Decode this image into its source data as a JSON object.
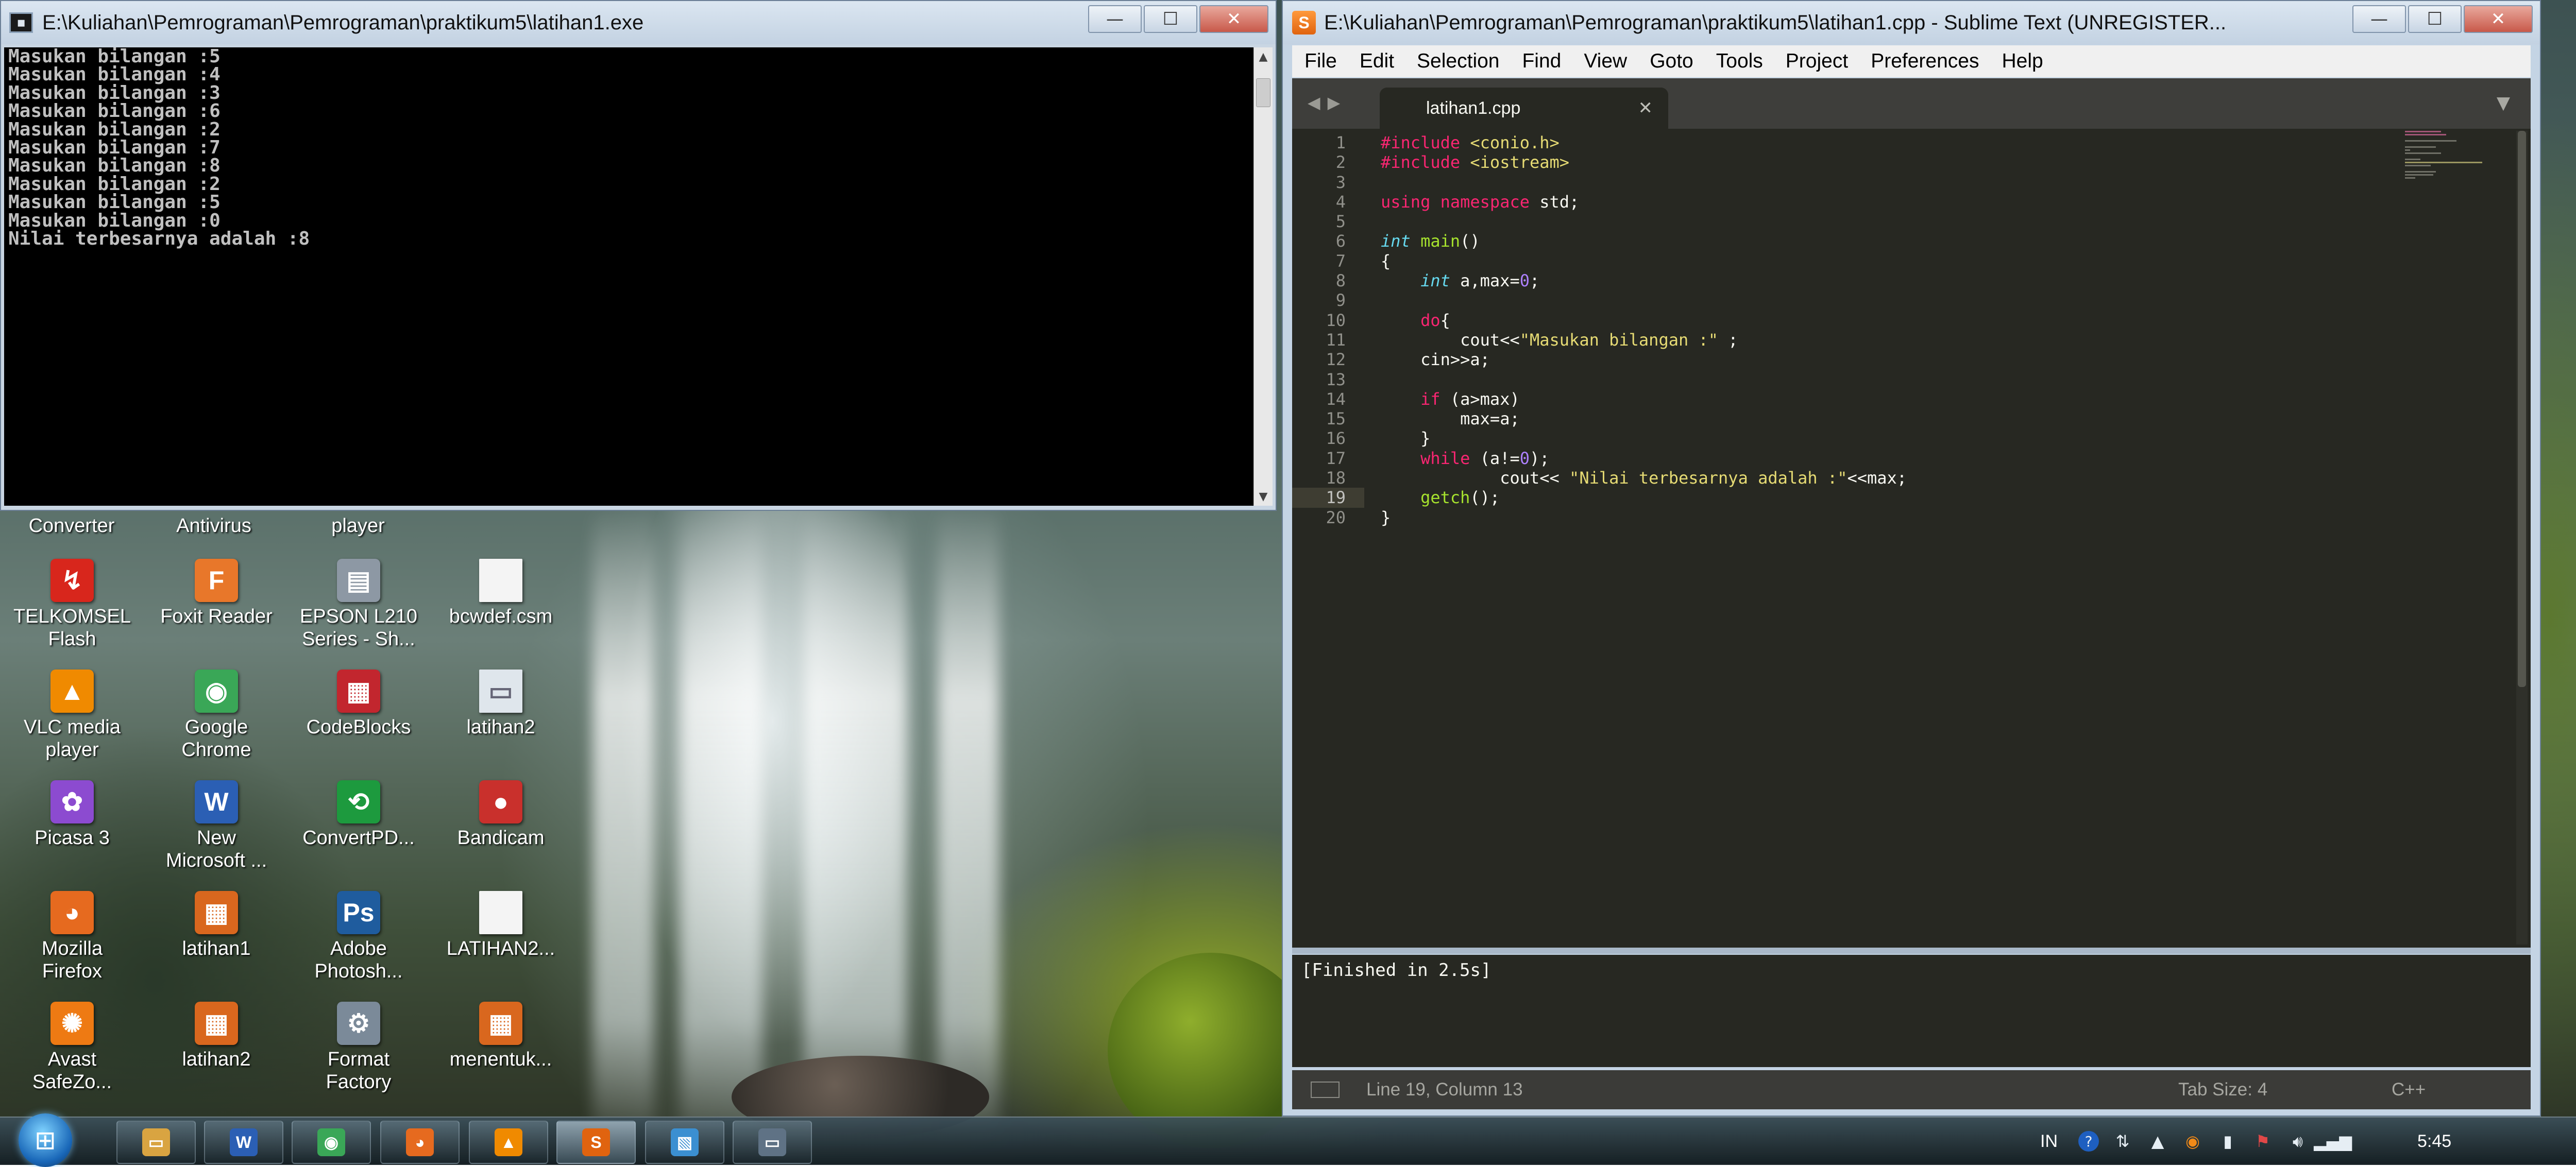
{
  "console": {
    "title": "E:\\Kuliahan\\Pemrograman\\Pemrograman\\praktikum5\\latihan1.exe",
    "output_lines": [
      "Masukan bilangan :5",
      "Masukan bilangan :4",
      "Masukan bilangan :3",
      "Masukan bilangan :6",
      "Masukan bilangan :2",
      "Masukan bilangan :7",
      "Masukan bilangan :8",
      "Masukan bilangan :2",
      "Masukan bilangan :5",
      "Masukan bilangan :0",
      "Nilai terbesarnya adalah :8"
    ],
    "controls": {
      "minimize": "—",
      "maximize": "☐",
      "close": "✕"
    }
  },
  "desktop": {
    "partial_labels": [
      "Converter",
      "Antivirus",
      "player"
    ],
    "icons": [
      {
        "label": "TELKOMSEL\nFlash",
        "icon": "telkomsel-flash-icon",
        "glyph": "↯",
        "color": "#d8261c"
      },
      {
        "label": "Foxit Reader",
        "icon": "foxit-reader-icon",
        "glyph": "F",
        "color": "#e8772a"
      },
      {
        "label": "EPSON L210\nSeries - Sh...",
        "icon": "epson-printer-icon",
        "glyph": "▤",
        "color": "#8d98a4"
      },
      {
        "label": "bcwdef.csm",
        "icon": "file-icon",
        "glyph": "",
        "color": "#f4f4f4"
      },
      {
        "label": "VLC media\nplayer",
        "icon": "vlc-icon",
        "glyph": "▲",
        "color": "#f08a00"
      },
      {
        "label": "Google\nChrome",
        "icon": "chrome-icon",
        "glyph": "◉",
        "color": "#3aa757"
      },
      {
        "label": "CodeBlocks",
        "icon": "codeblocks-icon",
        "glyph": "▦",
        "color": "#c2262e"
      },
      {
        "label": "latihan2",
        "icon": "exe-file-icon",
        "glyph": "▭",
        "color": "#dfe6ec"
      },
      {
        "label": "Picasa 3",
        "icon": "picasa-icon",
        "glyph": "✿",
        "color": "#8c4bd0"
      },
      {
        "label": "New\nMicrosoft ...",
        "icon": "word-doc-icon",
        "glyph": "W",
        "color": "#2b5fb4"
      },
      {
        "label": "ConvertPD...",
        "icon": "convertpdf-icon",
        "glyph": "⟲",
        "color": "#1d9a3e"
      },
      {
        "label": "Bandicam",
        "icon": "bandicam-icon",
        "glyph": "●",
        "color": "#c9302c"
      },
      {
        "label": "Mozilla\nFirefox",
        "icon": "firefox-icon",
        "glyph": "◕",
        "color": "#e66a1f"
      },
      {
        "label": "latihan1",
        "icon": "codeblocks-project-icon",
        "glyph": "▦",
        "color": "#d9671e"
      },
      {
        "label": "Adobe\nPhotosh...",
        "icon": "photoshop-icon",
        "glyph": "Ps",
        "color": "#1f5c9e"
      },
      {
        "label": "LATIHAN2...",
        "icon": "file-icon",
        "glyph": "",
        "color": "#f4f4f4"
      },
      {
        "label": "Avast\nSafeZo...",
        "icon": "avast-safezone-icon",
        "glyph": "✺",
        "color": "#ee7a13"
      },
      {
        "label": "latihan2",
        "icon": "codeblocks-project-icon",
        "glyph": "▦",
        "color": "#d9671e"
      },
      {
        "label": "Format\nFactory",
        "icon": "format-factory-icon",
        "glyph": "⚙",
        "color": "#7b8a99"
      },
      {
        "label": "menentuk...",
        "icon": "codeblocks-project-icon",
        "glyph": "▦",
        "color": "#d9671e"
      }
    ]
  },
  "sublime": {
    "title": "E:\\Kuliahan\\Pemrograman\\Pemrograman\\praktikum5\\latihan1.cpp - Sublime Text (UNREGISTER...",
    "menu": [
      "File",
      "Edit",
      "Selection",
      "Find",
      "View",
      "Goto",
      "Tools",
      "Project",
      "Preferences",
      "Help"
    ],
    "tab_name": "latihan1.cpp",
    "current_line": 19,
    "code_lines": [
      [
        {
          "t": "#include ",
          "c": "kw"
        },
        {
          "t": "<conio.h>",
          "c": "st"
        }
      ],
      [
        {
          "t": "#include ",
          "c": "kw"
        },
        {
          "t": "<iostream>",
          "c": "st"
        }
      ],
      [],
      [
        {
          "t": "using ",
          "c": "kw"
        },
        {
          "t": "namespace ",
          "c": "kw"
        },
        {
          "t": "std;",
          "c": ""
        }
      ],
      [],
      [
        {
          "t": "int ",
          "c": "ty"
        },
        {
          "t": "main",
          "c": "fn"
        },
        {
          "t": "()",
          "c": ""
        }
      ],
      [
        {
          "t": "{",
          "c": ""
        }
      ],
      [
        {
          "t": "    ",
          "c": ""
        },
        {
          "t": "int ",
          "c": "ty"
        },
        {
          "t": "a,max=",
          "c": ""
        },
        {
          "t": "0",
          "c": "nm"
        },
        {
          "t": ";",
          "c": ""
        }
      ],
      [],
      [
        {
          "t": "    ",
          "c": ""
        },
        {
          "t": "do",
          "c": "kw"
        },
        {
          "t": "{",
          "c": ""
        }
      ],
      [
        {
          "t": "        cout<<",
          "c": ""
        },
        {
          "t": "\"Masukan bilangan :\"",
          "c": "st"
        },
        {
          "t": " ;",
          "c": ""
        }
      ],
      [
        {
          "t": "    cin>>a;",
          "c": ""
        }
      ],
      [],
      [
        {
          "t": "    ",
          "c": ""
        },
        {
          "t": "if ",
          "c": "kw"
        },
        {
          "t": "(a>max)",
          "c": ""
        }
      ],
      [
        {
          "t": "        max=a;",
          "c": ""
        }
      ],
      [
        {
          "t": "    }",
          "c": ""
        }
      ],
      [
        {
          "t": "    ",
          "c": ""
        },
        {
          "t": "while ",
          "c": "kw"
        },
        {
          "t": "(a!=",
          "c": ""
        },
        {
          "t": "0",
          "c": "nm"
        },
        {
          "t": ");",
          "c": ""
        }
      ],
      [
        {
          "t": "            cout<< ",
          "c": ""
        },
        {
          "t": "\"Nilai terbesarnya adalah :\"",
          "c": "st"
        },
        {
          "t": "<<max;",
          "c": ""
        }
      ],
      [
        {
          "t": "    ",
          "c": ""
        },
        {
          "t": "getch",
          "c": "fn"
        },
        {
          "t": "();",
          "c": ""
        }
      ],
      [
        {
          "t": "}",
          "c": ""
        }
      ]
    ],
    "build_output": "[Finished in 2.5s]",
    "status": {
      "position": "Line 19, Column 13",
      "tab_size": "Tab Size: 4",
      "syntax": "C++"
    }
  },
  "taskbar": {
    "start_icon": "windows-start-icon",
    "apps": [
      {
        "name": "explorer",
        "icon": "folder-icon",
        "glyph": "▭",
        "color": "#d9a441",
        "active": false
      },
      {
        "name": "word",
        "icon": "word-icon",
        "glyph": "W",
        "color": "#2b5fb4",
        "active": false
      },
      {
        "name": "chrome",
        "icon": "chrome-icon",
        "glyph": "◉",
        "color": "#3aa757",
        "active": false
      },
      {
        "name": "firefox",
        "icon": "firefox-icon",
        "glyph": "◕",
        "color": "#e66a1f",
        "active": false
      },
      {
        "name": "vlc",
        "icon": "vlc-icon",
        "glyph": "▲",
        "color": "#f08a00",
        "active": false
      },
      {
        "name": "sublime",
        "icon": "sublime-icon",
        "glyph": "S",
        "color": "#e0630f",
        "active": true
      },
      {
        "name": "photos",
        "icon": "picture-icon",
        "glyph": "▧",
        "color": "#3b8fd1",
        "active": false
      },
      {
        "name": "console",
        "icon": "console-icon",
        "glyph": "▭",
        "color": "#5f7285",
        "active": false
      }
    ],
    "language": "IN",
    "clock": "5:45"
  }
}
